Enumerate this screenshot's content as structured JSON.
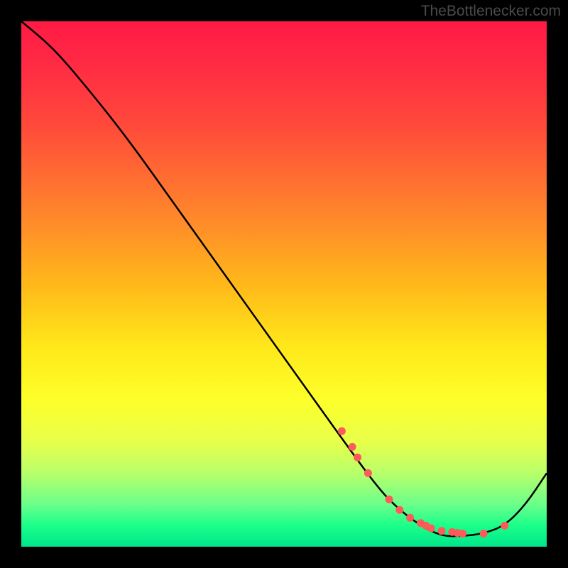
{
  "attribution": "TheBottlenecker.com",
  "chart_data": {
    "type": "line",
    "title": "",
    "xlabel": "",
    "ylabel": "",
    "xlim": [
      0,
      100
    ],
    "ylim": [
      0,
      100
    ],
    "series": [
      {
        "name": "curve",
        "x": [
          0,
          6,
          12,
          20,
          30,
          40,
          50,
          60,
          68,
          72,
          76,
          80,
          84,
          88,
          92,
          96,
          100
        ],
        "y": [
          100,
          95,
          88,
          78,
          64,
          50,
          36,
          22,
          11,
          7,
          4,
          2,
          2,
          2.5,
          4,
          8,
          14
        ]
      }
    ],
    "markers": {
      "name": "points",
      "color": "#ff5a5a",
      "x": [
        61,
        63,
        64,
        66,
        70,
        72,
        74,
        76,
        77,
        78,
        80,
        82,
        83,
        84,
        88,
        92
      ],
      "y": [
        22,
        19,
        17,
        14,
        9,
        7,
        5.5,
        4.5,
        4,
        3.5,
        3,
        2.8,
        2.6,
        2.5,
        2.5,
        4
      ]
    },
    "gradient_bands": [
      {
        "pos": 0,
        "color": "#ff1a44"
      },
      {
        "pos": 50,
        "color": "#ffe81a"
      },
      {
        "pos": 100,
        "color": "#00e68a"
      }
    ]
  }
}
